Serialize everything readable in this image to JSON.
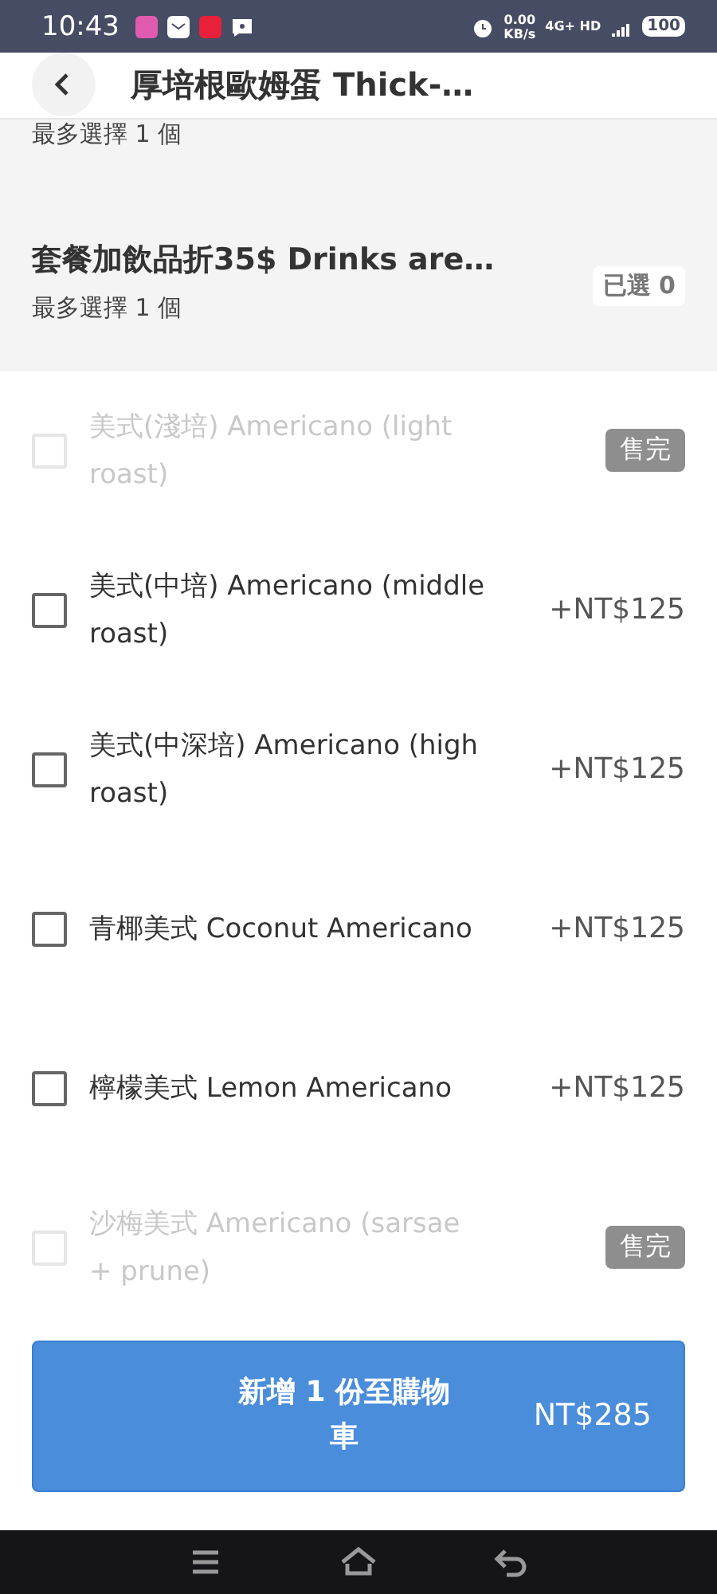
{
  "status_bar": {
    "time": "10:43",
    "speed_value": "0.00",
    "speed_unit": "KB/s",
    "network": "4G+ HD",
    "battery": "100"
  },
  "header": {
    "title": "厚培根歐姆蛋 Thick-…"
  },
  "prev_group": {
    "limit": "最多選擇 1 個"
  },
  "group": {
    "title": "套餐加飲品折35$ Drinks are…",
    "limit": "最多選擇 1 個",
    "selected_count": "已選 0"
  },
  "options": [
    {
      "name": "美式(淺培) Americano (light roast)",
      "disabled": true,
      "checked": false,
      "badge": "售完"
    },
    {
      "name": "美式(中培) Americano (middle roast)",
      "disabled": false,
      "checked": false,
      "price": "+NT$125"
    },
    {
      "name": "美式(中深培) Americano (high roast)",
      "disabled": false,
      "checked": false,
      "price": "+NT$125"
    },
    {
      "name": "青椰美式 Coconut Americano",
      "disabled": false,
      "checked": false,
      "price": "+NT$125"
    },
    {
      "name": "檸檬美式 Lemon Americano",
      "disabled": false,
      "checked": false,
      "price": "+NT$125"
    },
    {
      "name": "沙梅美式 Americano (sarsae + prune)",
      "disabled": true,
      "checked": false,
      "badge": "售完"
    }
  ],
  "cart_button": {
    "label": "新增 1 份至購物車",
    "total": "NT$285"
  }
}
